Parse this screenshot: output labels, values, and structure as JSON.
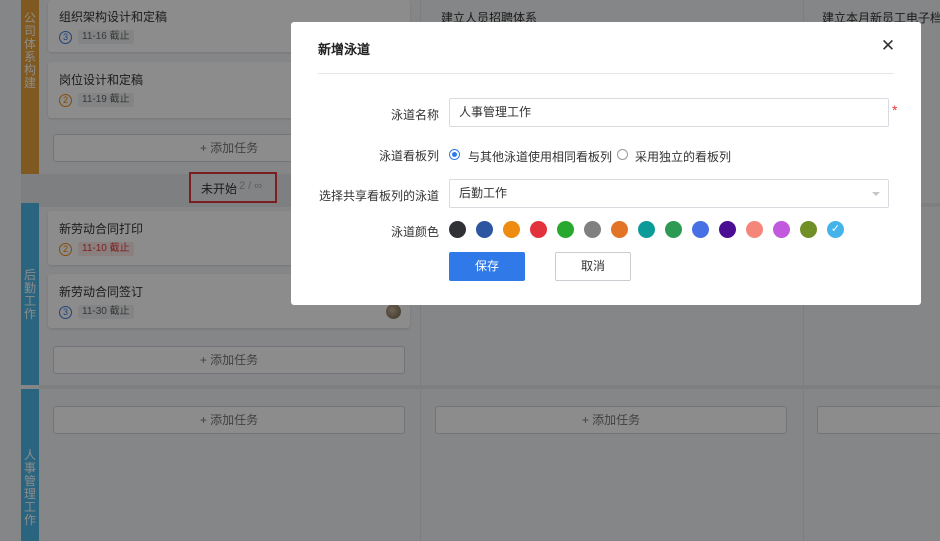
{
  "board": {
    "lanes": [
      {
        "name": [
          "公",
          "司",
          "体",
          "系",
          "构",
          "建"
        ],
        "color": "#e8a23a"
      },
      {
        "name": [
          "后",
          "勤",
          "工",
          "作"
        ],
        "color": "#4db6e5"
      },
      {
        "name": [
          "人",
          "事",
          "管",
          "理",
          "工",
          "作"
        ],
        "color": "#4db6e5"
      }
    ],
    "columns": [
      {
        "title": "建立人员招聘体系"
      },
      {
        "title": "建立本月新员工电子档"
      }
    ],
    "cards": [
      {
        "title": "组织架构设计和定稿",
        "priority": "3",
        "date": "11-16 截止"
      },
      {
        "title": "岗位设计和定稿",
        "priority": "2",
        "date": "11-19 截止"
      },
      {
        "title": "新劳动合同打印",
        "priority": "2",
        "date": "11-10 截止"
      },
      {
        "title": "新劳动合同签订",
        "priority": "3",
        "date": "11-30 截止"
      }
    ],
    "add_task_label": "+ 添加任务",
    "status_group": {
      "label": "未开始",
      "count": "2 / ∞"
    }
  },
  "modal": {
    "title": "新增泳道",
    "close_icon": "close-icon",
    "fields": {
      "name_label": "泳道名称",
      "name_value": "人事管理工作",
      "required_mark": "*",
      "board_label": "泳道看板列",
      "board_options": [
        {
          "label": "与其他泳道使用相同看板列",
          "selected": true
        },
        {
          "label": "采用独立的看板列",
          "selected": false
        }
      ],
      "share_label": "选择共享看板列的泳道",
      "share_value": "后勤工作",
      "color_label": "泳道颜色"
    },
    "colors": [
      "#2f3135",
      "#2d55a2",
      "#ee8b11",
      "#e2323e",
      "#27a92e",
      "#808080",
      "#e27327",
      "#0d9b99",
      "#2d9a53",
      "#4670e4",
      "#4b0d92",
      "#f4877a",
      "#c158de",
      "#718f27",
      "#43b3ea"
    ],
    "selected_color_index": 14,
    "save_label": "保存",
    "cancel_label": "取消"
  }
}
